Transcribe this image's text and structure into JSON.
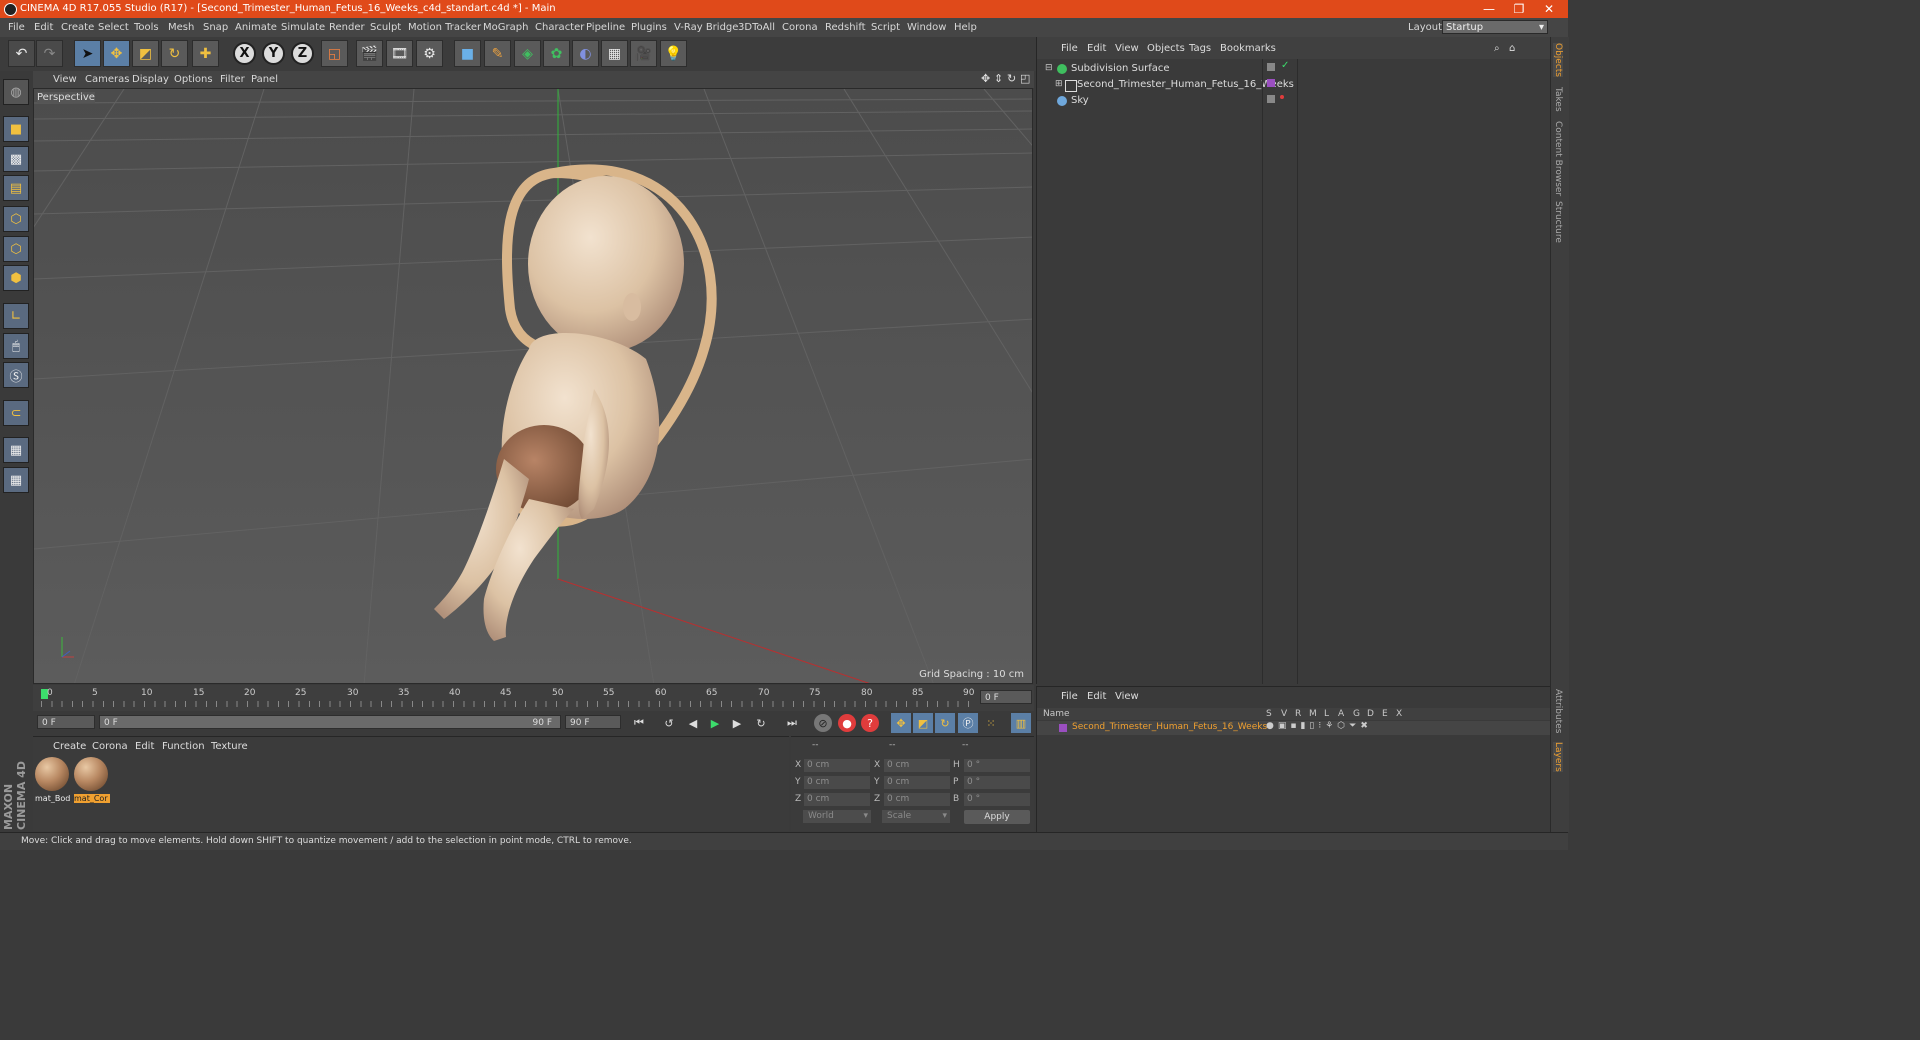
{
  "window": {
    "title": "CINEMA 4D R17.055 Studio (R17) - [Second_Trimester_Human_Fetus_16_Weeks_c4d_standart.c4d *] - Main",
    "minimize": "—",
    "restore": "❐",
    "close": "✕"
  },
  "menu": [
    "File",
    "Edit",
    "Create",
    "Select",
    "Tools",
    "Mesh",
    "Snap",
    "Animate",
    "Simulate",
    "Render",
    "Sculpt",
    "Motion Tracker",
    "MoGraph",
    "Character",
    "Pipeline",
    "Plugins",
    "V-Ray Bridge",
    "3DToAll",
    "Corona",
    "Redshift",
    "Script",
    "Window",
    "Help"
  ],
  "layout": {
    "label": "Layout:",
    "value": "Startup"
  },
  "axes": [
    "X",
    "Y",
    "Z"
  ],
  "viewport": {
    "menu": [
      "View",
      "Cameras",
      "Display",
      "Options",
      "Filter",
      "Panel"
    ],
    "label": "Perspective",
    "grid_spacing": "Grid Spacing : 10 cm"
  },
  "timeline": {
    "ticks": [
      "0",
      "5",
      "10",
      "15",
      "20",
      "25",
      "30",
      "35",
      "40",
      "45",
      "50",
      "55",
      "60",
      "65",
      "70",
      "75",
      "80",
      "85",
      "90"
    ],
    "current_frame": "0 F",
    "start_field": "0 F",
    "range_start": "0 F",
    "range_end": "90 F",
    "end_field": "90 F"
  },
  "materials": {
    "menu": [
      "Create",
      "Corona",
      "Edit",
      "Function",
      "Texture"
    ],
    "items": [
      {
        "name": "mat_Bod",
        "selected": false
      },
      {
        "name": "mat_Cor",
        "selected": true
      }
    ]
  },
  "coords": {
    "headers": [
      "--",
      "--",
      "--"
    ],
    "rows": [
      {
        "a": "X",
        "av": "0 cm",
        "b": "X",
        "bv": "0 cm",
        "c": "H",
        "cv": "0 °"
      },
      {
        "a": "Y",
        "av": "0 cm",
        "b": "Y",
        "bv": "0 cm",
        "c": "P",
        "cv": "0 °"
      },
      {
        "a": "Z",
        "av": "0 cm",
        "b": "Z",
        "bv": "0 cm",
        "c": "B",
        "cv": "0 °"
      }
    ],
    "space": "World",
    "mode": "Scale",
    "apply": "Apply"
  },
  "objects": {
    "menu": [
      "File",
      "Edit",
      "View",
      "Objects",
      "Tags",
      "Bookmarks"
    ],
    "items": [
      {
        "name": "Subdivision Surface",
        "color": "#3fbf5f"
      },
      {
        "name": "Second_Trimester_Human_Fetus_16_Weeks",
        "color": "#d0d0d0"
      },
      {
        "name": "Sky",
        "color": "#6fa8dc"
      }
    ]
  },
  "layers": {
    "menu": [
      "File",
      "Edit",
      "View"
    ],
    "header_name": "Name",
    "header_cols": [
      "S",
      "V",
      "R",
      "M",
      "L",
      "A",
      "G",
      "D",
      "E",
      "X"
    ],
    "items": [
      {
        "name": "Second_Trimester_Human_Fetus_16_Weeks",
        "color": "#9a4fc0"
      }
    ]
  },
  "right_tabs": [
    "Objects",
    "Takes",
    "Content Browser",
    "Structure",
    "Attributes",
    "Layers"
  ],
  "status": "Move: Click and drag to move elements. Hold down SHIFT to quantize movement / add to the selection in point mode, CTRL to remove.",
  "brand": {
    "line1": "MAXON",
    "line2": "CINEMA 4D"
  },
  "colors": {
    "title_bar": "#e04a1a",
    "accent": "#f0a030",
    "selection": "#5b7fa6"
  }
}
